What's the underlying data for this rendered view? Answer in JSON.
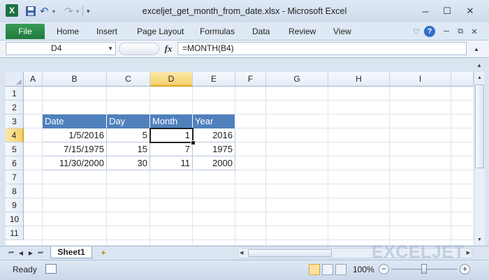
{
  "window": {
    "title": "exceljet_get_month_from_date.xlsx  -  Microsoft Excel",
    "app_icon_letter": "X",
    "minimize": "─",
    "maximize": "☐",
    "close": "✕"
  },
  "quick_access": {
    "undo_glyph": "↶",
    "redo_glyph": "↷",
    "dropdown_glyph": "▾",
    "customize_glyph": "▾"
  },
  "ribbon": {
    "file_label": "File",
    "tabs": [
      "Home",
      "Insert",
      "Page Layout",
      "Formulas",
      "Data",
      "Review",
      "View"
    ],
    "help_glyph": "?",
    "minimize_ribbon_glyph": "♡",
    "restore_glyph": "⧉",
    "close_glyph": "✕"
  },
  "formula_bar": {
    "name_box": "D4",
    "fx": "fx",
    "formula": "=MONTH(B4)",
    "dropdown_glyph": "▼",
    "expand_glyph": "▲"
  },
  "grid": {
    "columns": [
      "A",
      "B",
      "C",
      "D",
      "E",
      "F",
      "G",
      "H",
      "I"
    ],
    "rows": [
      "1",
      "2",
      "3",
      "4",
      "5",
      "6",
      "7",
      "8",
      "9",
      "10",
      "11"
    ],
    "active_column": "D",
    "active_row": "4",
    "selected_cell": "D4"
  },
  "table": {
    "headers": [
      "Date",
      "Day",
      "Month",
      "Year"
    ],
    "rows": [
      [
        "1/5/2016",
        "5",
        "1",
        "2016"
      ],
      [
        "7/15/1975",
        "15",
        "7",
        "1975"
      ],
      [
        "11/30/2000",
        "30",
        "11",
        "2000"
      ]
    ],
    "header_color": "#4f81bd"
  },
  "sheet_bar": {
    "nav_glyphs": [
      "⏮",
      "◀",
      "▶",
      "⏭"
    ],
    "active_sheet": "Sheet1",
    "watermark": "EXCELJET"
  },
  "status_bar": {
    "status": "Ready",
    "zoom": "100%",
    "zoom_out": "−",
    "zoom_in": "+"
  },
  "colors": {
    "file_tab": "#217346",
    "selection_highlight": "#f5cf6b"
  }
}
